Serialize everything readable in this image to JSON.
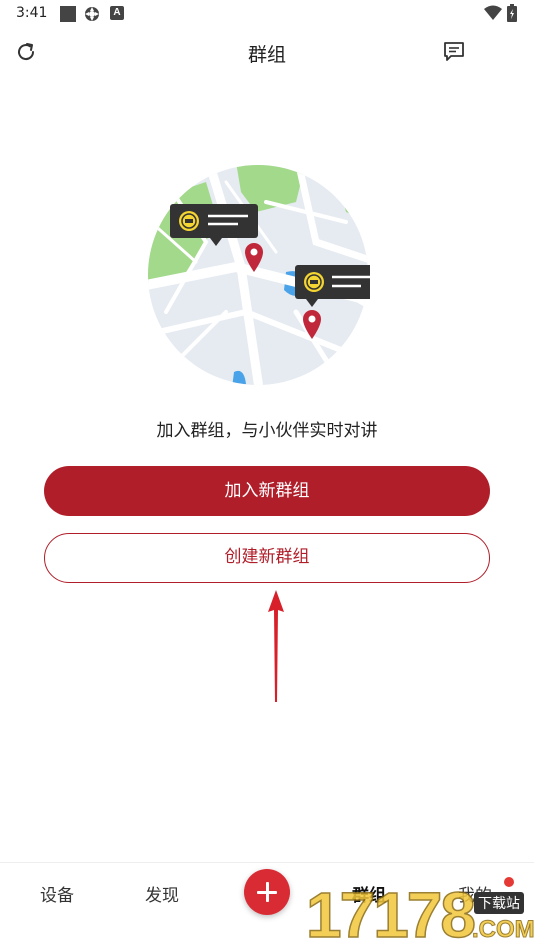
{
  "status_bar": {
    "time": "3:41",
    "icons": [
      "square-icon",
      "gear-icon",
      "a-icon",
      "wifi-icon",
      "battery-icon"
    ],
    "a_icon_letter": "A"
  },
  "header": {
    "title": "群组",
    "left_icon": "refresh-icon",
    "right_icon": "chat-icon"
  },
  "illustration": {
    "description_icon": "map-illustration"
  },
  "main": {
    "slogan": "加入群组，与小伙伴实时对讲",
    "join_button_label": "加入新群组",
    "create_button_label": "创建新群组"
  },
  "bottom_nav": {
    "items": [
      {
        "label": "设备"
      },
      {
        "label": "发现"
      },
      {
        "label": "群组",
        "active": true
      },
      {
        "label": "我的",
        "badge": true
      }
    ],
    "add_icon": "plus-icon"
  },
  "watermark": {
    "digits": "17178",
    "tag": "下载站",
    "domain": ".COM"
  },
  "colors": {
    "accent": "#b01e2a",
    "add_button": "#d92b34",
    "badge": "#e53935",
    "map_bg": "#e8edf3",
    "map_green": "#9fd882",
    "pin": "#c0273a"
  }
}
